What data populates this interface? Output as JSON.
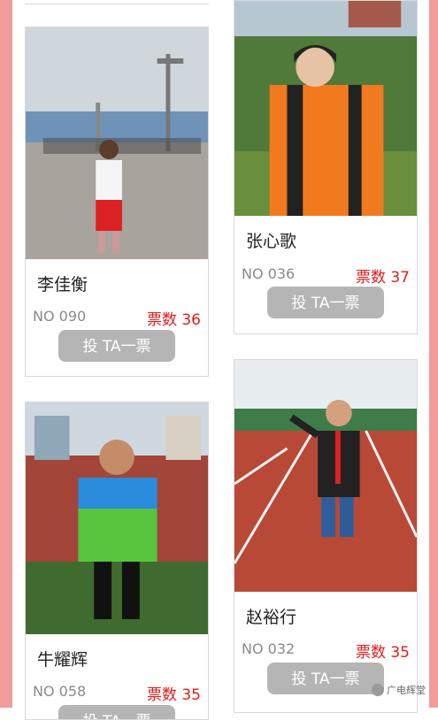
{
  "vote_button_label": "投 TA一票",
  "cards": [
    {
      "name": "李佳衡",
      "number": "NO 090",
      "votes": "票数 36"
    },
    {
      "name": "张心歌",
      "number": "NO 036",
      "votes": "票数 37"
    },
    {
      "name": "牛耀辉",
      "number": "NO 058",
      "votes": "票数 35"
    },
    {
      "name": "赵裕行",
      "number": "NO 032",
      "votes": "票数 35"
    }
  ],
  "watermark": "广电辉堂",
  "colors": {
    "accent": "#e21b1b",
    "side_bar": "#f29b9b",
    "button": "#b5b5b5"
  }
}
